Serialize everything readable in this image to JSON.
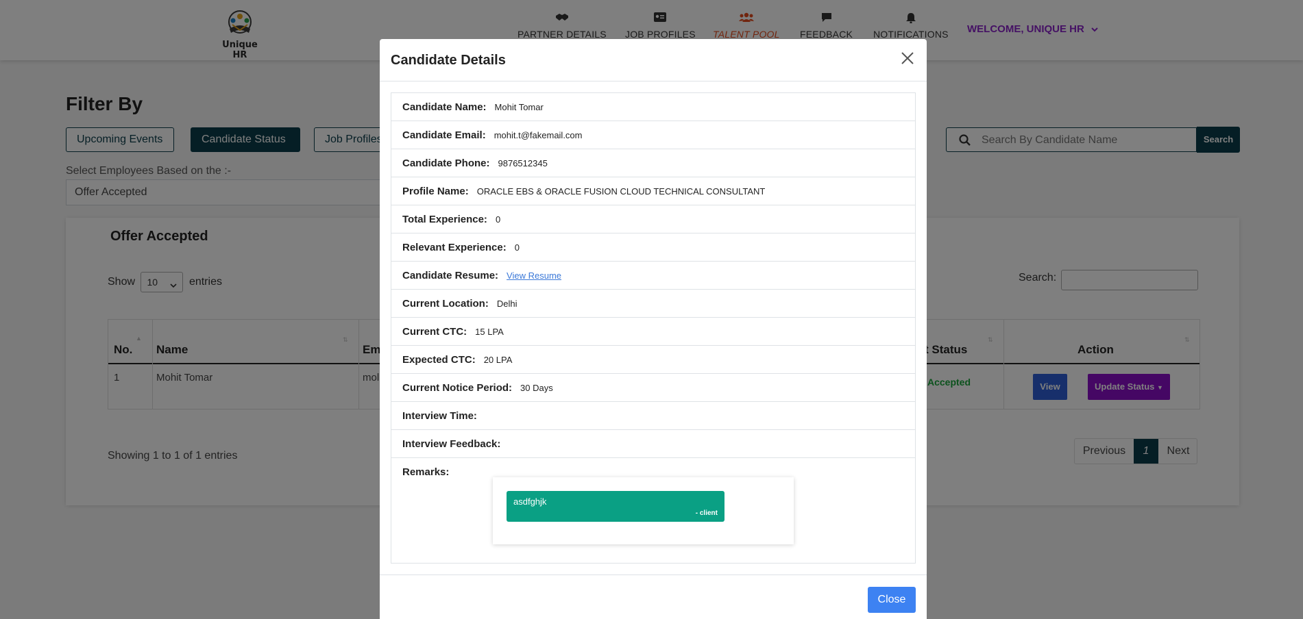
{
  "brand": {
    "name": "Unique HR"
  },
  "nav": {
    "items": [
      {
        "label": "PARTNER DETAILS",
        "icon": "handshake-icon"
      },
      {
        "label": "JOB PROFILES",
        "icon": "id-card-icon"
      },
      {
        "label": "TALENT POOL",
        "icon": "users-icon",
        "active": true
      },
      {
        "label": "FEEDBACK",
        "icon": "comment-icon"
      },
      {
        "label": "NOTIFICATIONS",
        "icon": "bell-icon"
      }
    ],
    "welcome": "WELCOME, UNIQUE HR"
  },
  "filter": {
    "title": "Filter By",
    "tabs": [
      "Upcoming Events",
      "Candidate Status",
      "Job Profiles"
    ],
    "select_label": "Select Employees Based on the :-",
    "select_value": "Offer Accepted",
    "search_placeholder": "Search By Candidate Name",
    "search_button": "Search"
  },
  "card": {
    "title": "Offer Accepted",
    "show_label": "Show",
    "entries_count": "10",
    "entries_label": "entries",
    "search_label": "Search:",
    "columns": [
      "No.",
      "Name",
      "Em",
      "t Status",
      "Action"
    ],
    "rows": [
      {
        "no": "1",
        "name": "Mohit Tomar",
        "email": "mol",
        "status": "Accepted"
      }
    ],
    "view_button": "View",
    "update_button": "Update Status",
    "showing": "Showing 1 to 1 of 1 entries",
    "pager": {
      "previous": "Previous",
      "current": "1",
      "next": "Next"
    }
  },
  "modal": {
    "title": "Candidate Details",
    "fields": {
      "name_label": "Candidate Name:",
      "name": "Mohit Tomar",
      "email_label": "Candidate Email:",
      "email": "mohit.t@fakemail.com",
      "phone_label": "Candidate Phone:",
      "phone": "9876512345",
      "profile_label": "Profile Name:",
      "profile": "ORACLE EBS & ORACLE FUSION CLOUD TECHNICAL CONSULTANT",
      "total_exp_label": "Total Experience:",
      "total_exp": "0",
      "relevant_exp_label": "Relevant Experience:",
      "relevant_exp": "0",
      "resume_label": "Candidate Resume:",
      "resume_link": "View Resume",
      "location_label": "Current Location:",
      "location": "Delhi",
      "ctc_label": "Current CTC:",
      "ctc": "15 LPA",
      "expected_ctc_label": "Expected CTC:",
      "expected_ctc": "20 LPA",
      "notice_label": "Current Notice Period:",
      "notice": "30 Days",
      "interview_time_label": "Interview Time:",
      "interview_feedback_label": "Interview Feedback:",
      "remarks_label": "Remarks:"
    },
    "remark": {
      "text": "asdfghjk",
      "author": "- client"
    },
    "close_button": "Close"
  },
  "colors": {
    "primary_dark": "#0b3d4a",
    "accent_purple": "#8a0fc9",
    "active_nav": "#e24a1d",
    "remark_green": "#0aa084",
    "close_blue": "#3d82f2"
  }
}
